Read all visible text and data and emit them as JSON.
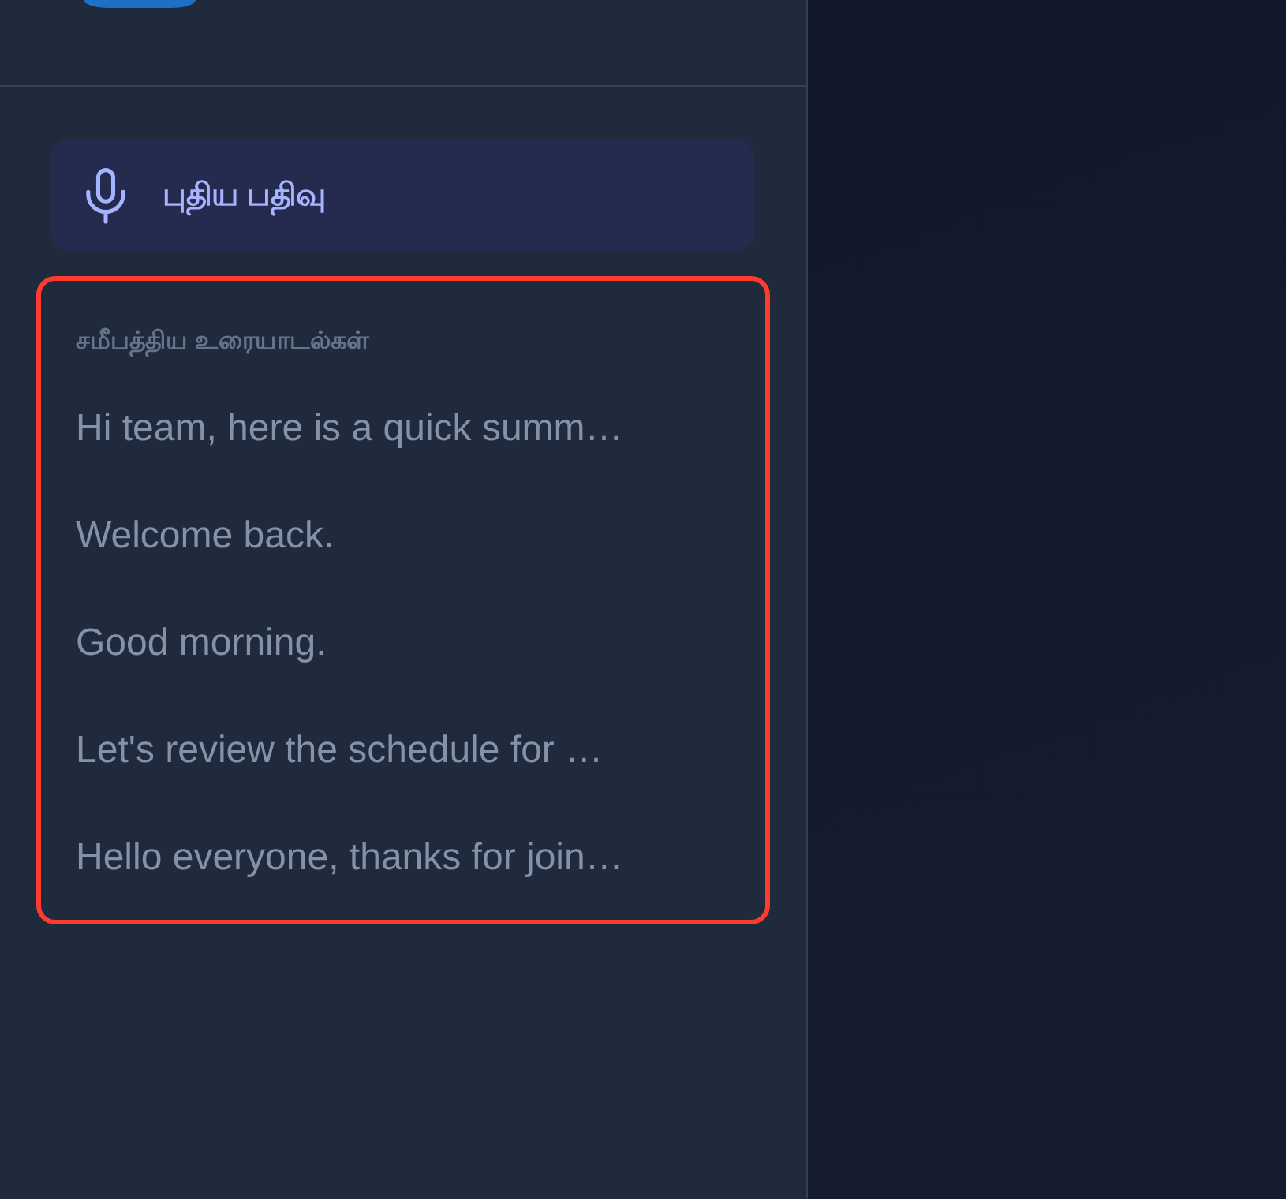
{
  "sidebar": {
    "new_recording_button": {
      "label": "புதிய பதிவு"
    },
    "recent": {
      "highlighted": true,
      "heading": "சமீபத்திய உரையாடல்கள்",
      "conversations": [
        {
          "title": "Hi team, here is a quick summ…",
          "selected": false
        },
        {
          "title": "Welcome back.",
          "selected": false
        },
        {
          "title": "Good morning.",
          "selected": false
        },
        {
          "title": "Let's review the schedule for …",
          "selected": false
        },
        {
          "title": "Hello everyone, thanks for join…",
          "selected": false
        }
      ]
    }
  }
}
